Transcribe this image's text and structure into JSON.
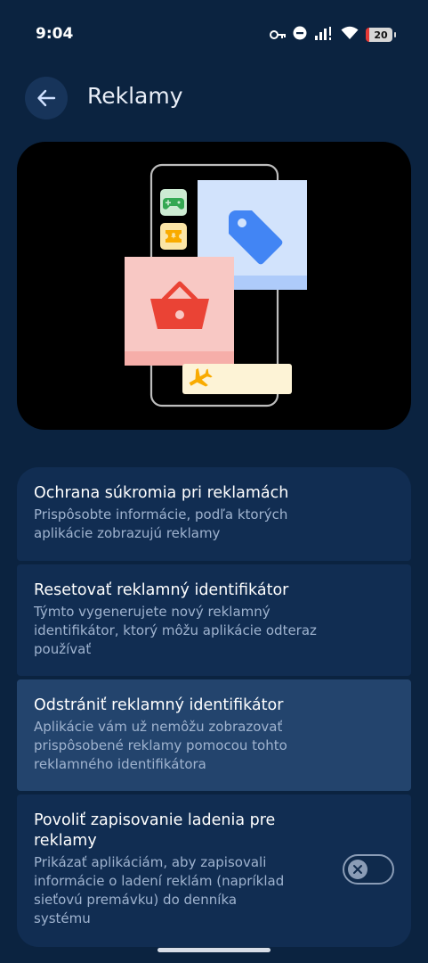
{
  "status_bar": {
    "time": "9:04",
    "battery": "20",
    "icons": [
      "key-icon",
      "do-not-disturb-icon",
      "signal-icon",
      "wifi-icon",
      "battery-icon"
    ]
  },
  "header": {
    "title": "Reklamy",
    "back_icon": "arrow-left-icon"
  },
  "illustration": {
    "icons": [
      "gamepad-icon",
      "ticket-icon",
      "tag-icon",
      "shopping-basket-icon",
      "airplane-icon"
    ],
    "colors": {
      "tag_card": "#d2e3fc",
      "basket_card": "#f8c8c4",
      "flight_card": "#fdf3d6"
    }
  },
  "settings": [
    {
      "title": "Ochrana súkromia pri reklamách",
      "lines": [
        "Prispôsobte informácie, podľa ktorých",
        "aplikácie zobrazujú reklamy"
      ]
    },
    {
      "title": "Resetovať reklamný identifikátor",
      "lines": [
        "Týmto vygenerujete nový reklamný",
        "identifikátor, ktorý môžu aplikácie odteraz",
        "používať"
      ]
    },
    {
      "title": "Odstrániť reklamný identifikátor",
      "lines": [
        "Aplikácie vám už nemôžu zobrazovať",
        "prispôsobené reklamy pomocou tohto",
        "reklamného identifikátora"
      ]
    },
    {
      "title_lines": [
        "Povoliť zapisovanie ladenia pre",
        "reklamy"
      ],
      "lines": [
        "Prikázať aplikáciám, aby zapisovali",
        "informácie o ladení reklám (napríklad",
        "sieťovú premávku) do denníka",
        "systému"
      ],
      "toggle": {
        "on": false,
        "icon": "close-icon"
      }
    }
  ]
}
